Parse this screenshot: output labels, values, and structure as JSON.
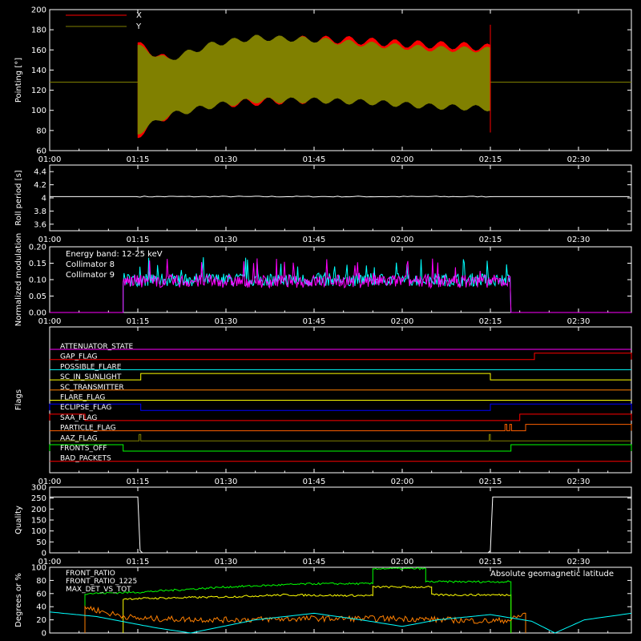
{
  "chart_data": [
    {
      "type": "line",
      "ylabel": "Pointing [°]",
      "ylim": [
        60,
        200
      ],
      "yticks": [
        60,
        80,
        100,
        120,
        140,
        160,
        180,
        200
      ],
      "xlim_min": [
        60,
        159
      ],
      "xticks_labels": [
        "01:00",
        "01:15",
        "01:30",
        "01:45",
        "02:00",
        "02:15",
        "02:30"
      ],
      "xticks_min": [
        60,
        75,
        90,
        105,
        120,
        135,
        150
      ],
      "legend": "top-left",
      "series": [
        {
          "name": "X",
          "color": "#ff0000",
          "upper_env": [
            [
              75,
              165
            ],
            [
              80,
              150
            ],
            [
              90,
              165
            ],
            [
              100,
              170
            ],
            [
              110,
              170
            ],
            [
              120,
              166
            ],
            [
              130,
              164
            ],
            [
              135,
              162
            ]
          ],
          "lower_env": [
            [
              75,
              75
            ],
            [
              78,
              90
            ],
            [
              85,
              105
            ],
            [
              100,
              110
            ],
            [
              110,
              111
            ],
            [
              120,
              112
            ],
            [
              135,
              112
            ]
          ]
        },
        {
          "name": "Y",
          "color": "#808000",
          "upper_env": [
            [
              75,
              163
            ],
            [
              80,
              150
            ],
            [
              88,
              166
            ],
            [
              95,
              172
            ],
            [
              105,
              170
            ],
            [
              115,
              165
            ],
            [
              125,
              161
            ],
            [
              135,
              160
            ]
          ],
          "lower_env": [
            [
              75,
              78
            ],
            [
              80,
              95
            ],
            [
              88,
              105
            ],
            [
              95,
              110
            ],
            [
              105,
              110
            ],
            [
              115,
              108
            ],
            [
              125,
              104
            ],
            [
              135,
              102
            ]
          ],
          "baseline": 128
        }
      ]
    },
    {
      "type": "line",
      "ylabel": "Roll period [s]",
      "ylim": [
        3.5,
        4.5
      ],
      "yticks": [
        3.6,
        3.8,
        4.0,
        4.2,
        4.4
      ],
      "xticks_labels": [
        "01:00",
        "01:15",
        "01:30",
        "01:45",
        "02:00",
        "02:15",
        "02:30"
      ],
      "series": [
        {
          "name": "",
          "color": "#ffffff",
          "value": 4.02
        }
      ]
    },
    {
      "type": "line",
      "ylabel": "Normalized modulation",
      "ylim": [
        0,
        0.2
      ],
      "yticks": [
        0.0,
        0.05,
        0.1,
        0.15,
        0.2
      ],
      "yticks_labels": [
        "0.00",
        "0.05",
        "0.10",
        "0.15",
        "0.20"
      ],
      "xticks_labels": [
        "01:00",
        "01:15",
        "01:30",
        "01:45",
        "02:00",
        "02:15",
        "02:30"
      ],
      "annotation": "Energy band: 12-25 keV",
      "series": [
        {
          "name": "Collimator 8",
          "color": "#00ffff",
          "start_min": 72.5,
          "end_min": 138.5,
          "level": 0.1
        },
        {
          "name": "Collimator 9",
          "color": "#ff00ff",
          "start_min": 72.5,
          "end_min": 138.5,
          "level": 0.095
        }
      ]
    },
    {
      "type": "line",
      "ylabel": "Flags",
      "xticks_labels": [
        "01:00",
        "01:15",
        "01:30",
        "01:45",
        "02:00",
        "02:15",
        "02:30"
      ],
      "series": [
        {
          "name": "ATTENUATOR_STATE",
          "color": "#ff00ff",
          "segments": []
        },
        {
          "name": "GAP_FLAG",
          "color": "#ff0000",
          "segments": [
            [
              142.5,
              159
            ]
          ]
        },
        {
          "name": "POSSIBLE_FLARE",
          "color": "#00ffff",
          "segments": []
        },
        {
          "name": "SC_IN_SUNLIGHT",
          "color": "#ffff00",
          "segments": [
            [
              75.5,
              135
            ]
          ]
        },
        {
          "name": "SC_TRANSMITTER",
          "color": "#ff8000",
          "segments": []
        },
        {
          "name": "FLARE_FLAG",
          "color": "#ffff00",
          "segments": []
        },
        {
          "name": "ECLIPSE_FLAG",
          "color": "#0000ff",
          "segments": [
            [
              60,
              75.5
            ],
            [
              135,
              159
            ]
          ]
        },
        {
          "name": "SAA_FLAG",
          "color": "#ff0000",
          "segments": [
            [
              60,
              66
            ],
            [
              140,
              159
            ]
          ]
        },
        {
          "name": "PARTICLE_FLAG",
          "color": "#ff6000",
          "segments": [
            [
              137.5,
              137.8
            ],
            [
              138.3,
              138.6
            ],
            [
              141,
              159
            ]
          ]
        },
        {
          "name": "AAZ_FLAG",
          "color": "#808000",
          "segments": [
            [
              75.2,
              75.5
            ],
            [
              134.8,
              135
            ]
          ]
        },
        {
          "name": "FRONTS_OFF",
          "color": "#00ff00",
          "segments": [
            [
              60,
              72.5
            ],
            [
              138.5,
              159
            ]
          ]
        },
        {
          "name": "BAD_PACKETS",
          "color": "#ff0000",
          "segments": []
        }
      ]
    },
    {
      "type": "line",
      "ylabel": "Quality",
      "ylim": [
        0,
        300
      ],
      "yticks": [
        0,
        50,
        100,
        150,
        200,
        250,
        300
      ],
      "xticks_labels": [
        "01:00",
        "01:15",
        "01:30",
        "01:45",
        "02:00",
        "02:15",
        "02:30"
      ],
      "series": [
        {
          "name": "",
          "color": "#ffffff",
          "points": [
            [
              60,
              255
            ],
            [
              75,
              255
            ],
            [
              75.4,
              10
            ],
            [
              75.8,
              0
            ],
            [
              134.6,
              0
            ],
            [
              135,
              10
            ],
            [
              135.4,
              255
            ],
            [
              159,
              255
            ]
          ]
        }
      ]
    },
    {
      "type": "line",
      "ylabel": "Degrees or %",
      "ylim": [
        0,
        100
      ],
      "yticks": [
        0,
        20,
        40,
        60,
        80,
        100
      ],
      "annotation": "Absolute geomagnetic latitude",
      "annotation_color": "#00ffff",
      "series": [
        {
          "name": "FRONT_RATIO",
          "color": "#ffff00",
          "points": [
            [
              72.5,
              0
            ],
            [
              72.5,
              52
            ],
            [
              90,
              55
            ],
            [
              100,
              58
            ],
            [
              110,
              57
            ],
            [
              115,
              57
            ],
            [
              115,
              70
            ],
            [
              125,
              70
            ],
            [
              125,
              58
            ],
            [
              138.5,
              58
            ],
            [
              138.5,
              0
            ]
          ]
        },
        {
          "name": "FRONT_RATIO_1225",
          "color": "#00ff00",
          "points": [
            [
              66,
              0
            ],
            [
              66,
              60
            ],
            [
              75,
              62
            ],
            [
              90,
              70
            ],
            [
              105,
              75
            ],
            [
              115,
              75
            ],
            [
              115,
              98
            ],
            [
              124,
              98
            ],
            [
              124,
              78
            ],
            [
              138.5,
              78
            ],
            [
              138.5,
              0
            ]
          ]
        },
        {
          "name": "MAX_DET_VS_TOT",
          "color": "#ff8000",
          "points": [
            [
              66,
              0
            ],
            [
              66,
              40
            ],
            [
              70,
              30
            ],
            [
              75,
              22
            ],
            [
              90,
              20
            ],
            [
              105,
              22
            ],
            [
              120,
              22
            ],
            [
              135,
              18
            ],
            [
              138.5,
              20
            ],
            [
              141,
              30
            ],
            [
              141,
              0
            ]
          ]
        },
        {
          "name": "",
          "color": "#00ffff",
          "points": [
            [
              60,
              32
            ],
            [
              68,
              25
            ],
            [
              78,
              8
            ],
            [
              84,
              0
            ],
            [
              95,
              20
            ],
            [
              105,
              30
            ],
            [
              113,
              20
            ],
            [
              120,
              10
            ],
            [
              126,
              20
            ],
            [
              135,
              28
            ],
            [
              142,
              18
            ],
            [
              146,
              0
            ],
            [
              151,
              20
            ],
            [
              159,
              30
            ]
          ]
        }
      ]
    }
  ]
}
